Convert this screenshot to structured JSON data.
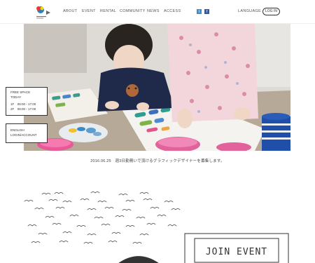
{
  "header": {
    "logo_icon": "logo-icon",
    "nav": [
      "ABOUT",
      "EVENT",
      "RENTAL",
      "COMMUNITY",
      "NEWS",
      "ACCESS"
    ],
    "social": [
      {
        "name": "twitter-icon",
        "glyph": "t"
      },
      {
        "name": "facebook-icon",
        "glyph": "f"
      }
    ],
    "language": "LANGUAGE",
    "login": "LOG IN"
  },
  "free_space": {
    "title": "FREE SPACE",
    "today": "TODAY",
    "lines": [
      "1F　09:00 - 17:00",
      "2F　09:00 - 17:00"
    ]
  },
  "account": {
    "english": "ENGLISH",
    "login_account": "LOGIN/ACCOUNT"
  },
  "news_caption": "2016.06.25　週3日勤務いで頂けるグラフィックデザイナーを募集します。",
  "join_event": "JOIN EVENT",
  "colors": {
    "twitter": "#3a8fd3",
    "facebook": "#3b5998",
    "border": "#333333"
  }
}
